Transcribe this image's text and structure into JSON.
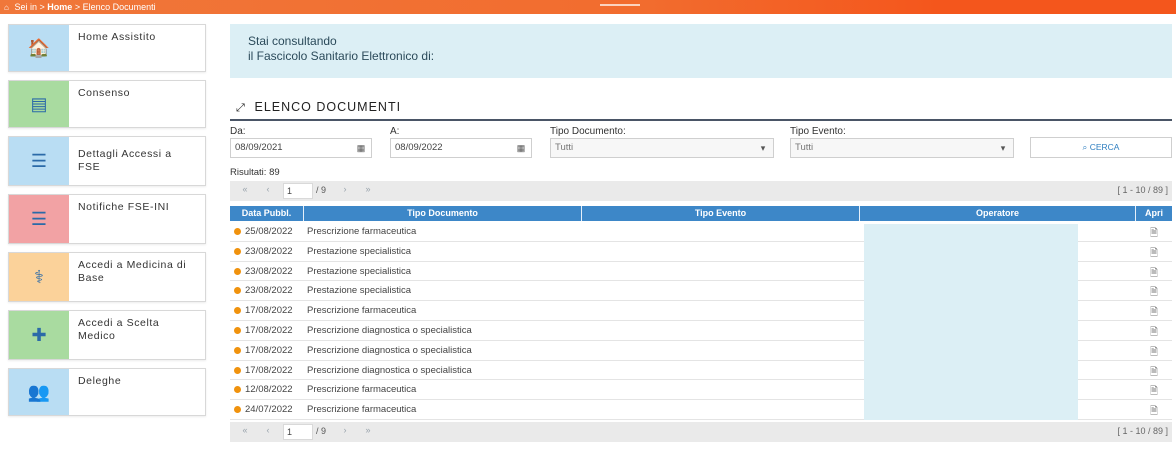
{
  "topbar": {
    "prefix": "Sei in > ",
    "home": "Home",
    "current": " > Elenco Documenti"
  },
  "sidebar": {
    "items": [
      {
        "label": "Home Assistito",
        "icon": "home-icon",
        "glyph": "🏠",
        "bg": "#b9ddf3"
      },
      {
        "label": "Consenso",
        "icon": "document-list-icon",
        "glyph": "▤",
        "bg": "#a9dba0"
      },
      {
        "label": "Dettagli Accessi a FSE",
        "icon": "list-icon",
        "glyph": "☰",
        "bg": "#b9ddf3"
      },
      {
        "label": "Notifiche FSE-INI",
        "icon": "list-icon",
        "glyph": "☰",
        "bg": "#f2a2a4"
      },
      {
        "label": "Accedi a Medicina di Base",
        "icon": "doctor-icon",
        "glyph": "⚕",
        "bg": "#fbd29a"
      },
      {
        "label": "Accedi a Scelta Medico",
        "icon": "medical-kit-icon",
        "glyph": "✚",
        "bg": "#a9dba0"
      },
      {
        "label": "Deleghe",
        "icon": "users-icon",
        "glyph": "👥",
        "bg": "#b9ddf3"
      }
    ]
  },
  "banner": {
    "line1": "Stai consultando",
    "line2": "il Fascicolo Sanitario Elettronico di:"
  },
  "section": {
    "title": "ELENCO DOCUMENTI"
  },
  "filters": {
    "da_label": "Da:",
    "da_value": "08/09/2021",
    "a_label": "A:",
    "a_value": "08/09/2022",
    "tipo_doc_label": "Tipo Documento:",
    "tipo_doc_value": "Tutti",
    "tipo_evento_label": "Tipo Evento:",
    "tipo_evento_value": "Tutti",
    "search_label": "CERCA"
  },
  "results": "Risultati: 89",
  "pager": {
    "page": "1",
    "total": "/ 9",
    "range": "[ 1 - 10 / 89 ]"
  },
  "table": {
    "columns": [
      "Data Pubbl.",
      "Tipo Documento",
      "Tipo Evento",
      "Operatore",
      "Apri"
    ],
    "rows": [
      {
        "date": "25/08/2022",
        "tipo": "Prescrizione farmaceutica"
      },
      {
        "date": "23/08/2022",
        "tipo": "Prestazione specialistica"
      },
      {
        "date": "23/08/2022",
        "tipo": "Prestazione specialistica"
      },
      {
        "date": "23/08/2022",
        "tipo": "Prestazione specialistica"
      },
      {
        "date": "17/08/2022",
        "tipo": "Prescrizione farmaceutica"
      },
      {
        "date": "17/08/2022",
        "tipo": "Prescrizione diagnostica o specialistica"
      },
      {
        "date": "17/08/2022",
        "tipo": "Prescrizione diagnostica o specialistica"
      },
      {
        "date": "17/08/2022",
        "tipo": "Prescrizione diagnostica o specialistica"
      },
      {
        "date": "12/08/2022",
        "tipo": "Prescrizione farmaceutica"
      },
      {
        "date": "24/07/2022",
        "tipo": "Prescrizione farmaceutica"
      }
    ]
  },
  "colors": {
    "accent": "#f26c2e",
    "table_header": "#3d87c8",
    "status_dot": "#f0920d",
    "banner_bg": "#dceff5"
  }
}
